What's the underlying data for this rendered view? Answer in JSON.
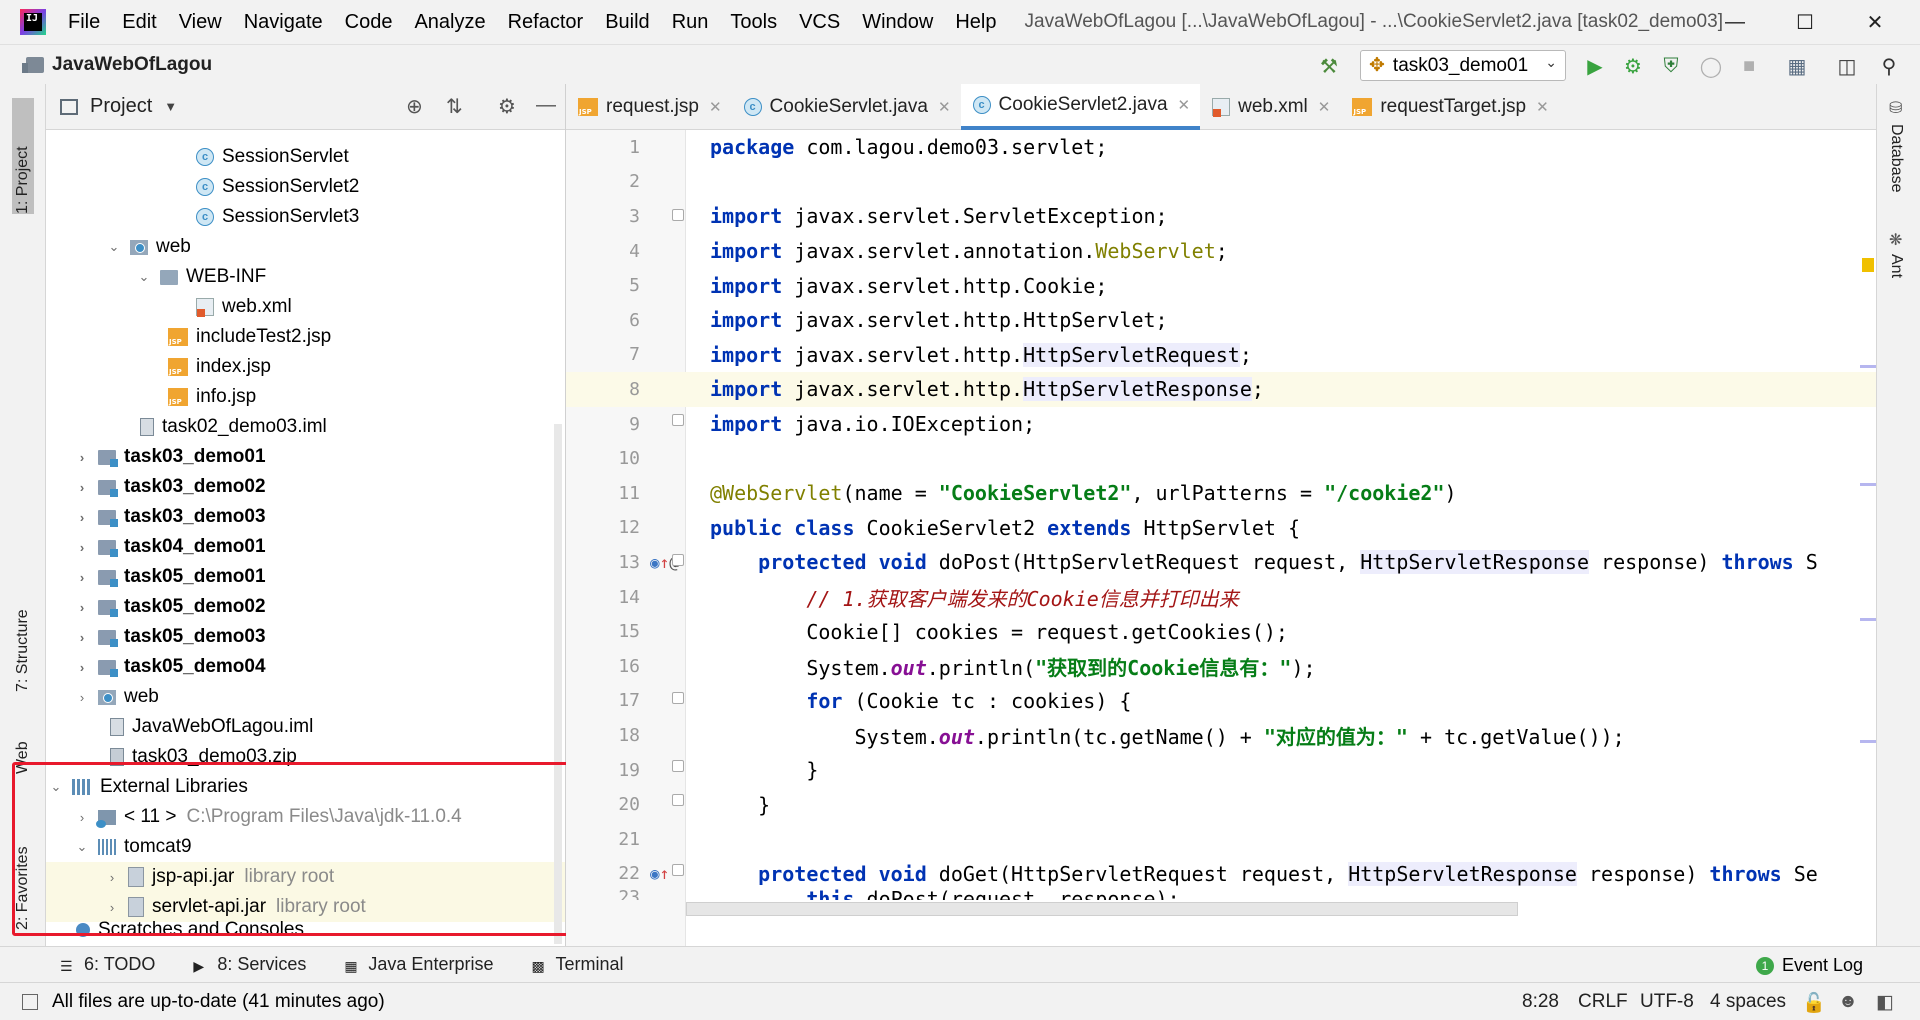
{
  "menu": [
    "File",
    "Edit",
    "View",
    "Navigate",
    "Code",
    "Analyze",
    "Refactor",
    "Build",
    "Run",
    "Tools",
    "VCS",
    "Window",
    "Help"
  ],
  "window_title": "JavaWebOfLagou [...\\JavaWebOfLagou] - ...\\CookieServlet2.java [task02_demo03]",
  "navbar": {
    "project": "JavaWebOfLagou",
    "run_config": "task03_demo01"
  },
  "left_tabs": {
    "project": "1: Project",
    "structure": "7: Structure",
    "web": "Web",
    "favorites": "2: Favorites"
  },
  "right_tabs": {
    "database": "Database",
    "ant": "Ant"
  },
  "project_panel": {
    "title": "Project",
    "rows": [
      {
        "label": "SessionServlet",
        "icon": "class"
      },
      {
        "label": "SessionServlet2",
        "icon": "class"
      },
      {
        "label": "SessionServlet3",
        "icon": "class"
      },
      {
        "label": "web",
        "icon": "webfolder"
      },
      {
        "label": "WEB-INF",
        "icon": "folder"
      },
      {
        "label": "web.xml",
        "icon": "xml"
      },
      {
        "label": "includeTest2.jsp",
        "icon": "jsp"
      },
      {
        "label": "index.jsp",
        "icon": "jsp"
      },
      {
        "label": "info.jsp",
        "icon": "jsp"
      },
      {
        "label": "task02_demo03.iml",
        "icon": "iml"
      },
      {
        "label": "task03_demo01",
        "icon": "module"
      },
      {
        "label": "task03_demo02",
        "icon": "module"
      },
      {
        "label": "task03_demo03",
        "icon": "module"
      },
      {
        "label": "task04_demo01",
        "icon": "module"
      },
      {
        "label": "task05_demo01",
        "icon": "module"
      },
      {
        "label": "task05_demo02",
        "icon": "module"
      },
      {
        "label": "task05_demo03",
        "icon": "module"
      },
      {
        "label": "task05_demo04",
        "icon": "module"
      },
      {
        "label": "web",
        "icon": "webfolder"
      },
      {
        "label": "JavaWebOfLagou.iml",
        "icon": "iml"
      },
      {
        "label": "task03_demo03.zip",
        "icon": "zip"
      },
      {
        "label": "External Libraries",
        "icon": "libs"
      },
      {
        "label": "< 11 >",
        "icon": "jdk",
        "note": "C:\\Program Files\\Java\\jdk-11.0.4"
      },
      {
        "label": "tomcat9",
        "icon": "lib"
      },
      {
        "label": "jsp-api.jar",
        "icon": "jar",
        "note": "library root"
      },
      {
        "label": "servlet-api.jar",
        "icon": "jar",
        "note": "library root"
      },
      {
        "label": "Scratches and Consoles",
        "icon": "scratch"
      }
    ]
  },
  "tabs": [
    {
      "label": "request.jsp",
      "icon": "jsp"
    },
    {
      "label": "CookieServlet.java",
      "icon": "class"
    },
    {
      "label": "CookieServlet2.java",
      "icon": "class"
    },
    {
      "label": "web.xml",
      "icon": "xml"
    },
    {
      "label": "requestTarget.jsp",
      "icon": "jsp"
    }
  ],
  "line_numbers": [
    "1",
    "2",
    "3",
    "4",
    "5",
    "6",
    "7",
    "8",
    "9",
    "10",
    "11",
    "12",
    "13",
    "14",
    "15",
    "16",
    "17",
    "18",
    "19",
    "20",
    "21",
    "22",
    "23"
  ],
  "code": {
    "l1": [
      "package",
      " com.lagou.demo03.servlet;"
    ],
    "l3": [
      "import",
      " javax.servlet.ServletException;"
    ],
    "l4": [
      "import",
      " javax.servlet.annotation.",
      "WebServlet",
      ";"
    ],
    "l5": [
      "import",
      " javax.servlet.http.Cookie;"
    ],
    "l6": [
      "import",
      " javax.servlet.http.HttpServlet;"
    ],
    "l7": [
      "import",
      " javax.servlet.http.",
      "HttpServletRequest",
      ";"
    ],
    "l8": [
      "import",
      " javax.servlet.http.",
      "HttpServletResponse",
      ";"
    ],
    "l9": [
      "import",
      " java.io.IOException;"
    ],
    "l11": [
      "@WebServlet",
      "(name = ",
      "\"CookieServlet2\"",
      ", urlPatterns = ",
      "\"/cookie2\"",
      ")"
    ],
    "l12": [
      "public class",
      " CookieServlet2 ",
      "extends",
      " HttpServlet {"
    ],
    "l13": [
      "    ",
      "protected void",
      " doPost(HttpServletRequest request, ",
      "HttpServletResponse",
      " response) ",
      "throws",
      " S"
    ],
    "l14": [
      "        ",
      "// 1.获取客户端发来的Cookie信息并打印出来"
    ],
    "l15": [
      "        Cookie[] cookies = request.getCookies();"
    ],
    "l16": [
      "        System.",
      "out",
      ".println(",
      "\"获取到的Cookie信息有：\"",
      ");"
    ],
    "l17": [
      "        ",
      "for",
      " (Cookie tc : cookies) {"
    ],
    "l18": [
      "            System.",
      "out",
      ".println(tc.getName() + ",
      "\"对应的值为：\"",
      " + tc.getValue());"
    ],
    "l19": [
      "        }"
    ],
    "l20": [
      "    }"
    ],
    "l22": [
      "    ",
      "protected void",
      " doGet(HttpServletRequest request, ",
      "HttpServletResponse",
      " response) ",
      "throws",
      " Se"
    ],
    "l23": [
      "        ",
      "this",
      ".doPost(request, response);"
    ]
  },
  "bottom_tools": [
    "6: TODO",
    "8: Services",
    "Java Enterprise",
    "Terminal"
  ],
  "event_log": "Event Log",
  "status": {
    "message": "All files are up-to-date (41 minutes ago)",
    "position": "8:28",
    "line_sep": "CRLF",
    "encoding": "UTF-8",
    "indent": "4 spaces"
  }
}
